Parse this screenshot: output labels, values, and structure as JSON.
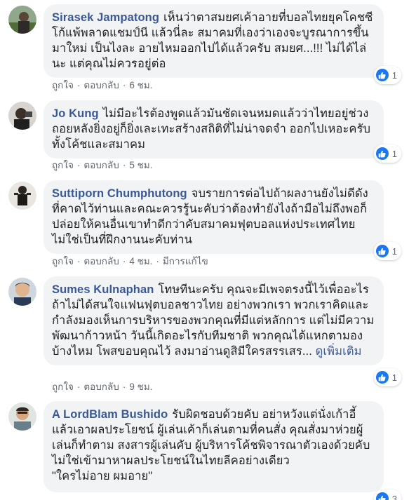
{
  "comments": [
    {
      "author": "Sirasek Jampatong",
      "text": "เห็นว่าตาสมยศเค้าอายที่บอลไทยยุคโคชซีโก้แพ้พลาดแชมป์นี แล้วนี่ละ สมาคมที่เองว่าเองจะบูรณาการขึ้นมาใหม่ เป็นไงละ อายไหมออกไปได้แล้วครับ สมยศ...!!! ไม่ได้ไล่นะ แต่คุณไม่ควรอยู่ต่อ",
      "see_more": "",
      "like": "ถูกใจ",
      "reply": "ตอบกลับ",
      "time": "6 ชม.",
      "edited": "",
      "reaction_count": "1"
    },
    {
      "author": "Jo Kung",
      "text": "ไม่มีอะไรต้องพูดแล้วมันชัดเจนหมดแล้วว่าไทยอยู่ช่วงถอยหลังยิ่งอยู่ก็ยิ่งเละเทะสร้างสถิติที่ไม่น่าจดจำ ออกไปเหอะครับทั้งโค้ชและสมาคม",
      "see_more": "",
      "like": "ถูกใจ",
      "reply": "ตอบกลับ",
      "time": "5 ชม.",
      "edited": "",
      "reaction_count": "1"
    },
    {
      "author": "Suttiporn Chumphutong",
      "text": "จบรายการต่อไปถ้าผลงานยังไม่ดีดังที่คาดไว้ท่านและคณะควรรู้นะคับว่าต้องทำยังไงถ้ามือไม่ถึงพอก็ปล่อยให้คนอื่นเขาทำดีกว่าคับสมาคมฟุตบอลแห่งประเทศไทยไม่ใช่เป็นที่ฝึกงานนะคับท่าน",
      "see_more": "",
      "like": "ถูกใจ",
      "reply": "ตอบกลับ",
      "time": "4 ชม.",
      "edited": "มีการแก้ไข",
      "reaction_count": "1"
    },
    {
      "author": "Sumes Kulnaphan",
      "text": "โทษทีนะครับ คุณจะมีเพจตรงนี้ไว้เพื่ออะไร ถ้าไม่ได้สนใจแฟนฟุตบอลชาวไทย อย่างพวกเรา พวกเราคิดและกำลังมองเห็นการบริหารของพวกคุณที่มีแต่หลักการ แต่ไม่มีความพัฒนาก้าวหน้า วันนี้เกิดอะไรกับทีมชาติ พวกคุณได้แหกตามองบ้างไหม โพสขอบคุณไว้ ลงมาอ่านดูสิมีใครสรรเสร...",
      "see_more": "ดูเพิ่มเติม",
      "like": "ถูกใจ",
      "reply": "ตอบกลับ",
      "time": "9 ชม.",
      "edited": "",
      "reaction_count": "1"
    },
    {
      "author": "A LordBlam Bushido",
      "text": "รับผิดชอบด้วยคับ อย่าหวังแต่นั่งเก้าอี้แล้วเอาผลประโยชน์ ผู้เล่นเค้าก็เล่นตามที่คนสั่ง คุณสั่งมาห่วยผู้เล่นก็ทำตาม สงสารผู้เล่นคับ ผู้บริหารโค้ชพิจารณาตัวเองด้วยคับ ไม่ใช่เข้ามาหาผลประโยชน์ในไทยลีคอย่างเดียว\n\"ใครไม่อาย ผมอาย\"",
      "see_more": "",
      "like": "",
      "reply": "",
      "time": "",
      "edited": "",
      "reaction_count": "3"
    }
  ],
  "icons": {
    "reaction": "like-thumb-icon",
    "avatar": "user-avatar"
  },
  "colors": {
    "author": "#385898",
    "bubble": "#f2f3f5",
    "like_blue": "#1877f2",
    "meta": "#606770"
  }
}
